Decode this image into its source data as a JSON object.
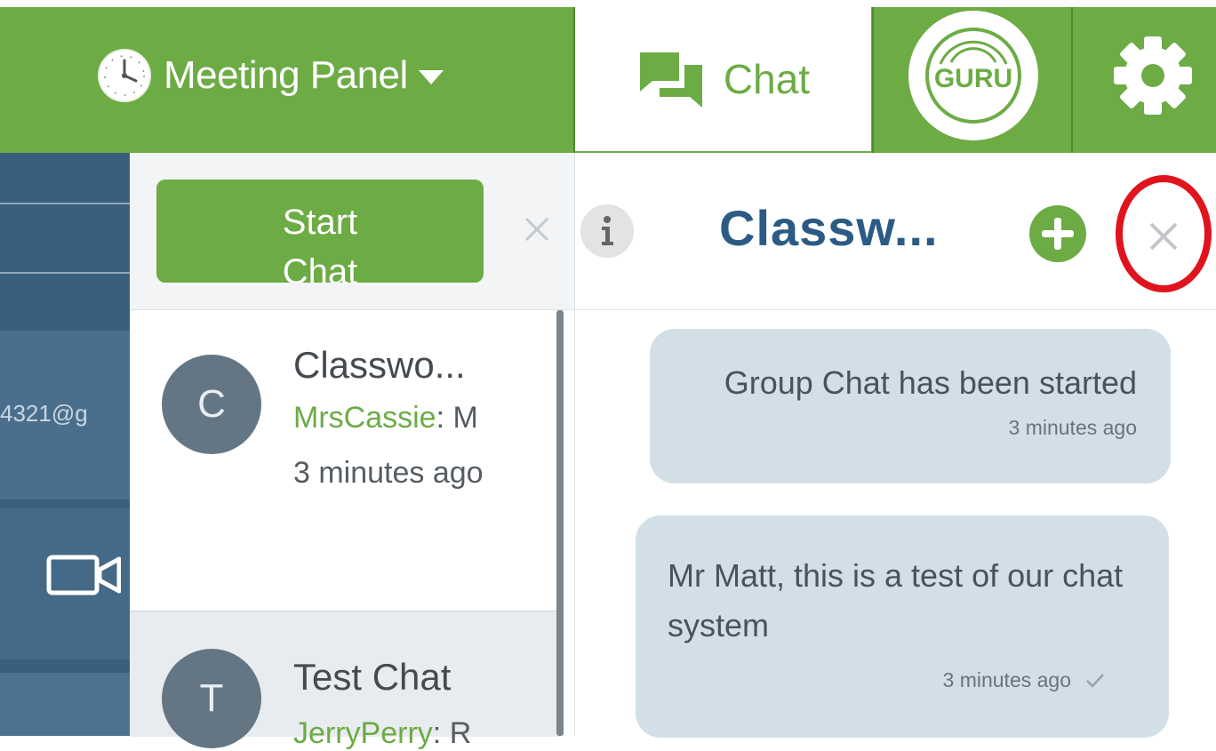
{
  "header": {
    "meeting_panel_label": "Meeting Panel",
    "chat_tab_label": "Chat",
    "logo_text": "GURU",
    "accent_color": "#6dab45"
  },
  "sidebar": {
    "email_fragment": "4321@g"
  },
  "conversation_list": {
    "start_chat_label_line1": "Start",
    "start_chat_label_line2": "Chat",
    "items": [
      {
        "avatar_letter": "C",
        "title": "Classwo...",
        "sender": "MrsCassie",
        "preview": ": M",
        "time": "3 minutes ago"
      },
      {
        "avatar_letter": "T",
        "title": "Test Chat",
        "sender": "JerryPerry",
        "preview": ": R"
      }
    ]
  },
  "chat": {
    "title": "Classw...",
    "messages": [
      {
        "text": "Group Chat has been started",
        "time": "3 minutes ago"
      },
      {
        "text": "Mr Matt, this is a test of our chat system",
        "time": "3 minutes ago",
        "status": "sent-check"
      }
    ]
  },
  "icons": {
    "meeting": "clock-icon",
    "chat_tab": "chat-bubbles-icon",
    "settings": "gear-icon",
    "video": "video-camera-icon",
    "info": "info-icon",
    "add": "plus-circle-icon",
    "close": "close-icon"
  }
}
